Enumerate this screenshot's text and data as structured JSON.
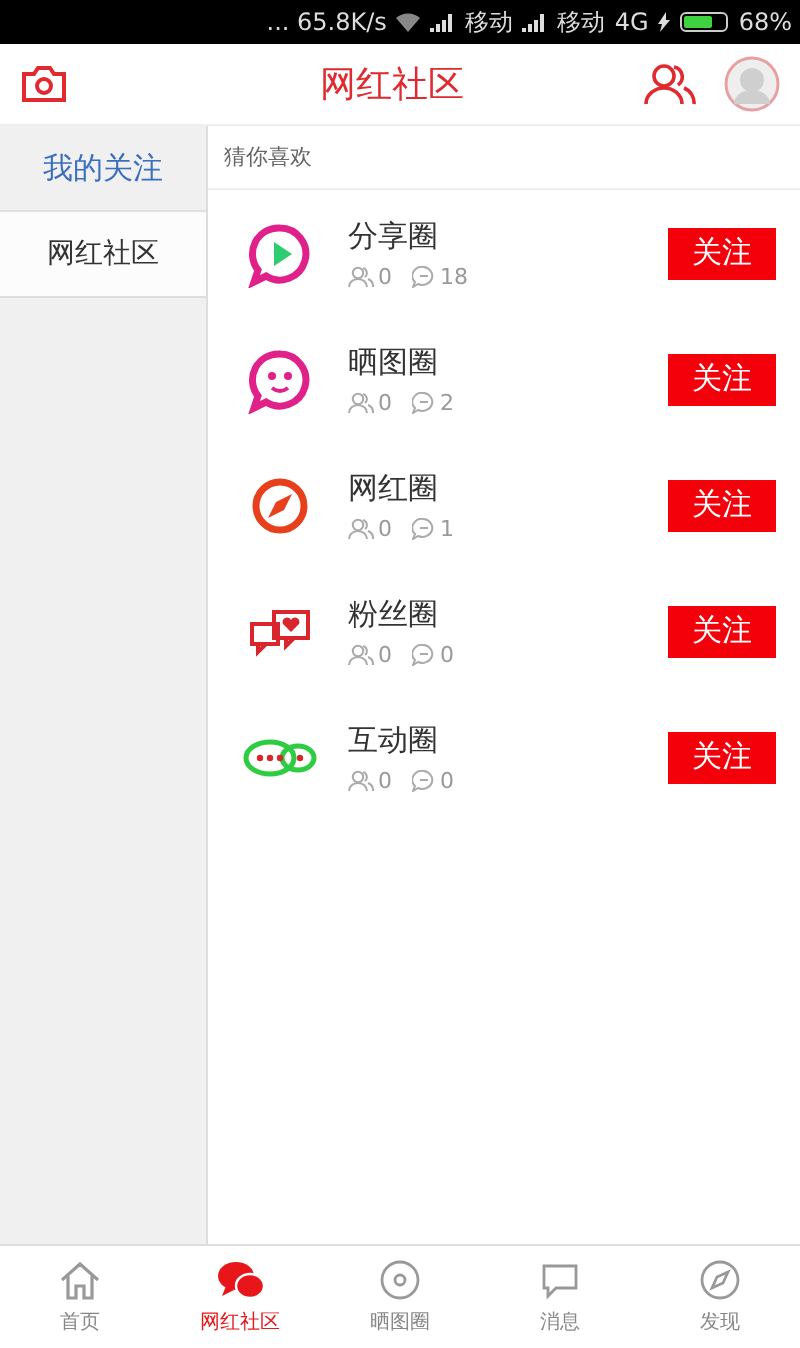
{
  "status_bar": {
    "speed": "... 65.8K/s",
    "carrier_1": "移动",
    "carrier_2": "移动",
    "network": "4G",
    "battery": "68%"
  },
  "header": {
    "title": "网红社区"
  },
  "sidebar": {
    "title": "我的关注",
    "items": [
      {
        "label": "网红社区",
        "selected": true
      }
    ]
  },
  "content": {
    "section_title": "猜你喜欢",
    "circles": [
      {
        "kind": "play",
        "name": "分享圈",
        "members": "0",
        "posts": "18",
        "button": "关注"
      },
      {
        "kind": "smile",
        "name": "晒图圈",
        "members": "0",
        "posts": "2",
        "button": "关注"
      },
      {
        "kind": "compass",
        "name": "网红圈",
        "members": "0",
        "posts": "1",
        "button": "关注"
      },
      {
        "kind": "hearts",
        "name": "粉丝圈",
        "members": "0",
        "posts": "0",
        "button": "关注"
      },
      {
        "kind": "chat",
        "name": "互动圈",
        "members": "0",
        "posts": "0",
        "button": "关注"
      }
    ]
  },
  "tab_bar": [
    {
      "kind": "home",
      "label": "首页",
      "selected": false
    },
    {
      "kind": "community",
      "label": "网红社区",
      "selected": true
    },
    {
      "kind": "photo",
      "label": "晒图圈",
      "selected": false
    },
    {
      "kind": "message",
      "label": "消息",
      "selected": false
    },
    {
      "kind": "discover",
      "label": "发现",
      "selected": false
    }
  ]
}
